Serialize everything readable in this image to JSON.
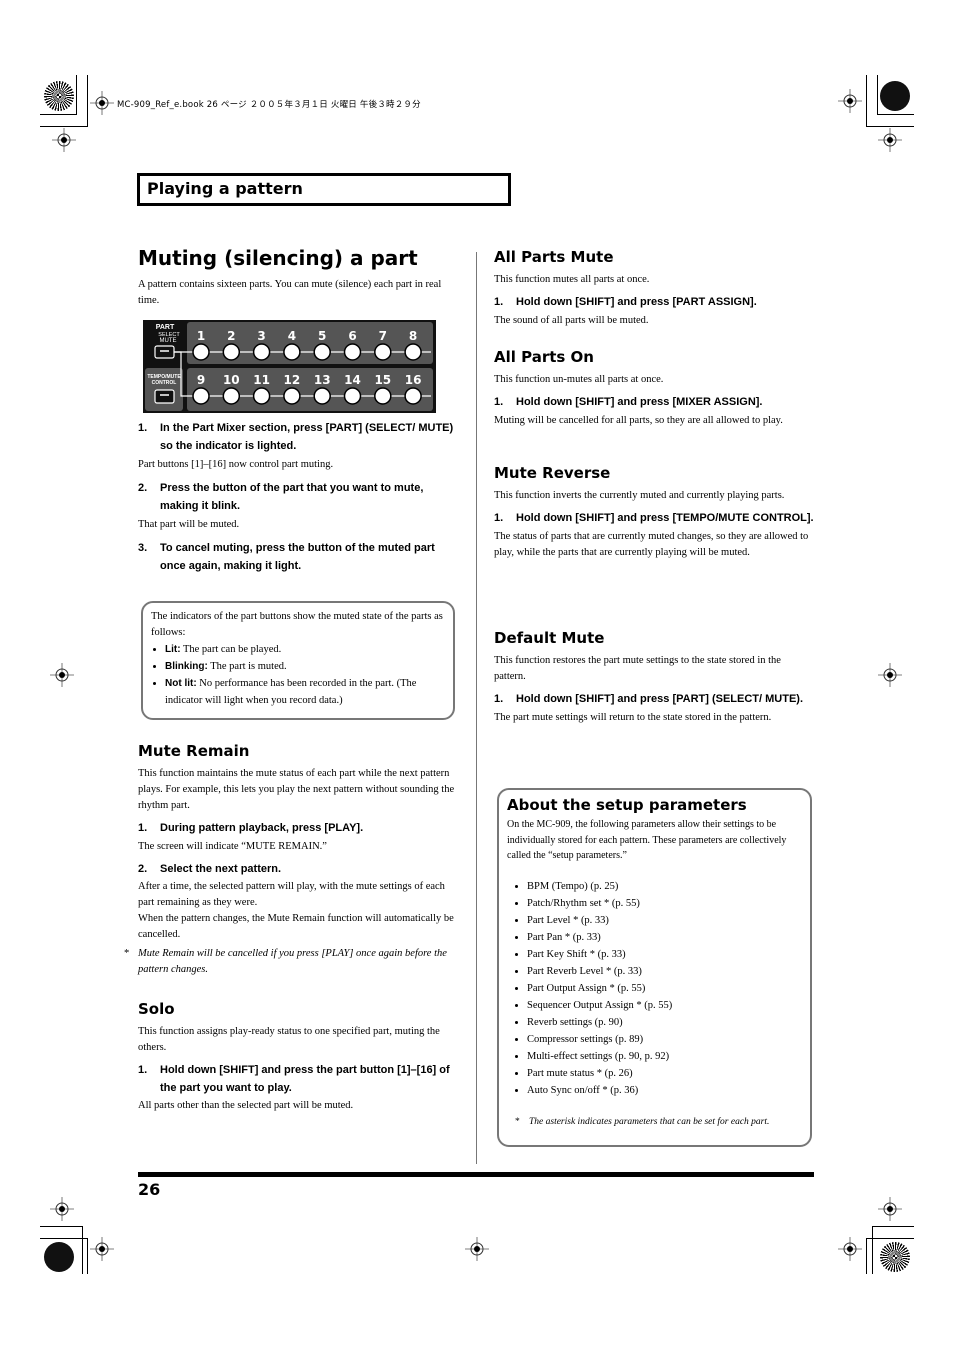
{
  "file_header": "MC-909_Ref_e.book  26 ページ  ２００５年３月１日  火曜日  午後３時２９分",
  "chapter_title": "Playing a pattern",
  "page_number": "26",
  "left": {
    "title": "Muting (silencing) a part",
    "intro": "A pattern contains sixteen parts. You can mute (silence) each part in real time.",
    "panel": {
      "part_label": "PART",
      "select_label": "SELECT",
      "mute_label": "MUTE",
      "tempo_label": "TEMPO/MUTE",
      "control_label": "CONTROL",
      "buttons_row1": [
        "1",
        "2",
        "3",
        "4",
        "5",
        "6",
        "7",
        "8"
      ],
      "buttons_row2": [
        "9",
        "10",
        "11",
        "12",
        "13",
        "14",
        "15",
        "16"
      ]
    },
    "steps": [
      {
        "num": "1.",
        "text": "In the Part Mixer section, press [PART] (SELECT/ MUTE) so the indicator is lighted.",
        "desc": "Part buttons [1]–[16] now control part muting."
      },
      {
        "num": "2.",
        "text": "Press the button of the part that you want to mute, making it blink.",
        "desc": "That part will be muted."
      },
      {
        "num": "3.",
        "text": "To cancel muting, press the button of the muted part once again, making it light.",
        "desc": ""
      }
    ],
    "info_box": {
      "intro": "The indicators of the part buttons show the muted state of the parts as follows:",
      "items": [
        {
          "label": "Lit:",
          "text": " The part can be played."
        },
        {
          "label": "Blinking:",
          "text": " The part is muted."
        },
        {
          "label": "Not lit:",
          "text": " No performance has been recorded in the part. (The indicator will light when you record data.)"
        }
      ]
    },
    "mute_remain": {
      "title": "Mute Remain",
      "intro": "This function maintains the mute status of each part while the next pattern plays. For example, this lets you play the next pattern without sounding the rhythm part.",
      "step1": {
        "num": "1.",
        "text": "During pattern playback, press [PLAY].",
        "desc": "The screen will indicate “MUTE REMAIN.”"
      },
      "step2": {
        "num": "2.",
        "text": "Select the next pattern.",
        "desc": "After a time, the selected pattern will play, with the mute settings of each part remaining as they were.",
        "desc2": "When the pattern changes, the Mute Remain function will automatically be cancelled."
      },
      "note": "Mute Remain will be cancelled if you press [PLAY] once again before the pattern changes."
    },
    "solo": {
      "title": "Solo",
      "intro": "This function assigns play-ready status to one specified part, muting the others.",
      "step1": {
        "num": "1.",
        "text": "Hold down [SHIFT] and press the part button [1]–[16] of the part you want to play.",
        "desc": "All parts other than the selected part will be muted."
      }
    }
  },
  "right": {
    "all_parts_mute": {
      "title": "All Parts Mute",
      "intro": "This function mutes all parts at once.",
      "step1": {
        "num": "1.",
        "text": "Hold down [SHIFT] and press [PART ASSIGN].",
        "desc": "The sound of all parts will be muted."
      }
    },
    "all_parts_on": {
      "title": "All Parts On",
      "intro": "This function un-mutes all parts at once.",
      "step1": {
        "num": "1.",
        "text": "Hold down [SHIFT] and press [MIXER ASSIGN].",
        "desc": "Muting will be cancelled for all parts, so they are all allowed to play."
      }
    },
    "mute_reverse": {
      "title": "Mute Reverse",
      "intro": "This function inverts the currently muted and currently playing parts.",
      "step1": {
        "num": "1.",
        "text": "Hold down [SHIFT] and press [TEMPO/MUTE CONTROL].",
        "desc": "The status of parts that are currently muted changes, so they are allowed to play, while the parts that are currently playing will be muted."
      }
    },
    "default_mute": {
      "title": "Default Mute",
      "intro": "This function restores the part mute settings to the state stored in the pattern.",
      "step1": {
        "num": "1.",
        "text": "Hold down [SHIFT] and press [PART] (SELECT/ MUTE).",
        "desc": "The part mute settings will return to the state stored in the pattern."
      }
    },
    "setup_box": {
      "title": "About the setup parameters",
      "intro": "On the MC-909, the following parameters allow their settings to be individually stored for each pattern. These parameters are collectively called the “setup parameters.”",
      "items": [
        "BPM (Tempo) (p. 25)",
        "Patch/Rhythm set * (p. 55)",
        "Part Level * (p. 33)",
        "Part Pan * (p. 33)",
        "Part Key Shift * (p. 33)",
        "Part Reverb Level * (p. 33)",
        "Part Output Assign * (p. 55)",
        "Sequencer Output Assign * (p. 55)",
        "Reverb settings (p. 90)",
        "Compressor settings (p. 89)",
        "Multi-effect settings (p. 90, p. 92)",
        "Part mute status * (p. 26)",
        "Auto Sync on/off * (p. 36)"
      ],
      "note": "The asterisk indicates parameters that can be set for each part."
    }
  }
}
